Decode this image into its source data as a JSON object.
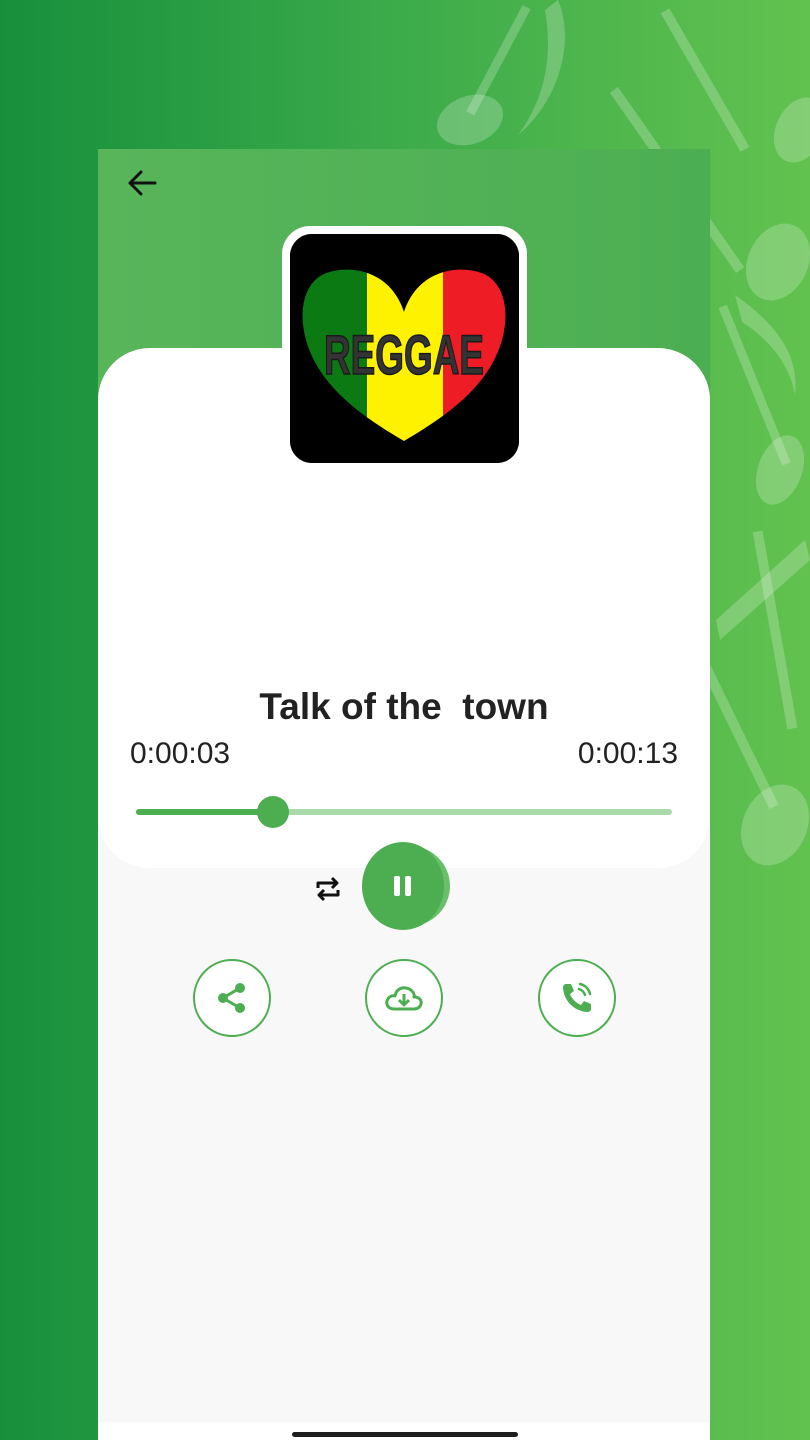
{
  "player": {
    "song_title": "Talk of the  town",
    "artwork_text": "REGGAE",
    "elapsed": "0:00:03",
    "total": "0:00:13",
    "progress": 0.255,
    "state": "playing"
  },
  "icons": {
    "back": "arrow-left-icon",
    "repeat": "repeat-icon",
    "pause": "pause-icon",
    "share": "share-icon",
    "download": "cloud-download-icon",
    "ringtone": "phone-ring-icon"
  },
  "colors": {
    "accent": "#4cae50",
    "accent_light": "#a8dba9",
    "header": "#58b55a",
    "card": "#ffffff",
    "page": "#f8f8f8"
  }
}
